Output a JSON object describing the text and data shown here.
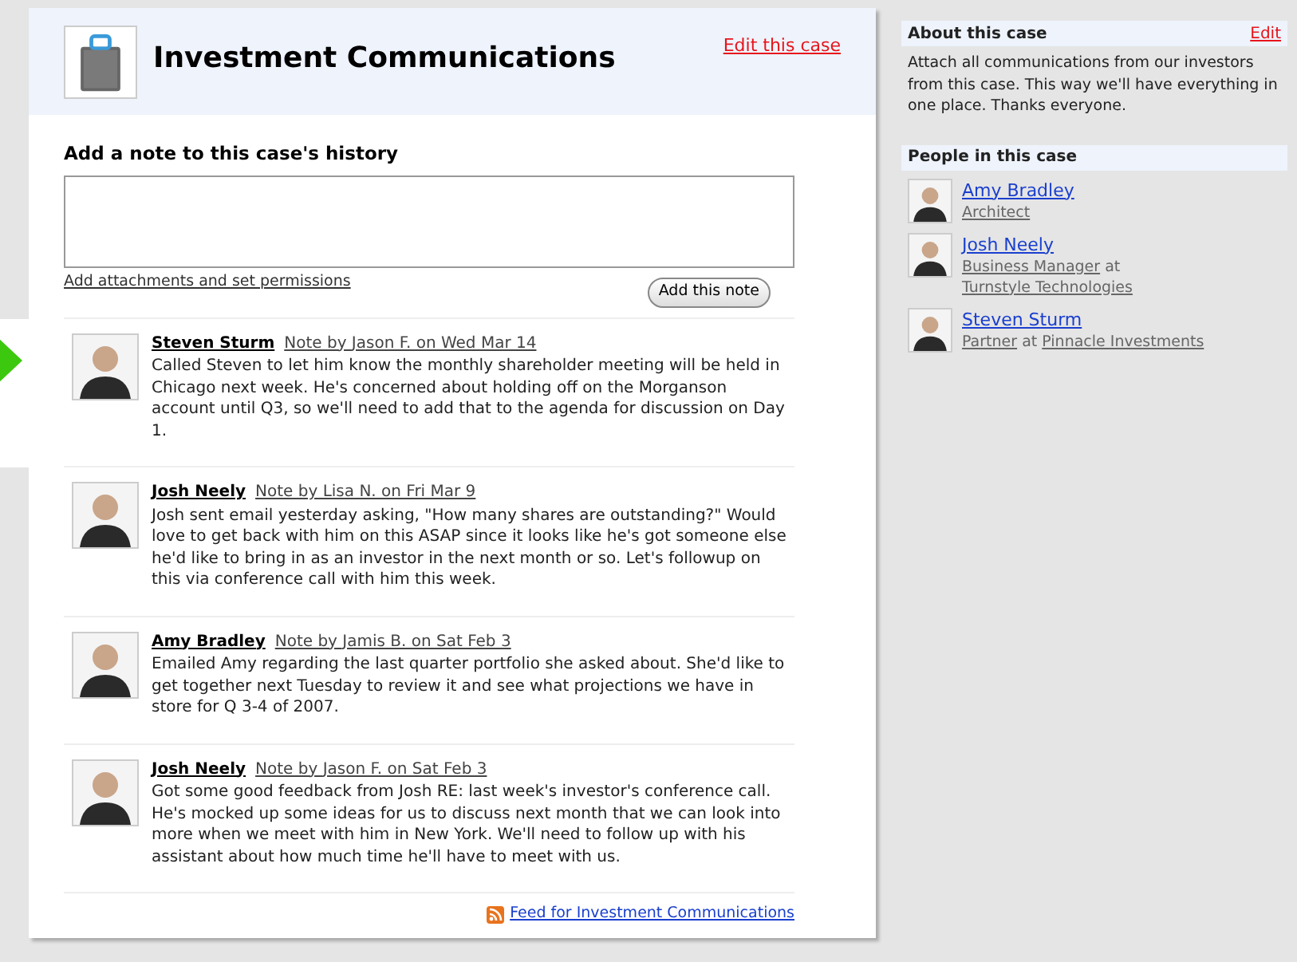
{
  "case": {
    "title": "Investment Communications",
    "edit_link": "Edit this case"
  },
  "note_form": {
    "heading": "Add a note to this case's history",
    "attachments_link": "Add attachments and set permissions",
    "submit": "Add this note"
  },
  "notes": [
    {
      "person": "Steven Sturm",
      "meta": "Note by Jason F. on Wed Mar 14",
      "body": "Called Steven to let him know the monthly shareholder meeting will be held in Chicago next week. He's concerned about holding off on the Morganson account until Q3, so we'll need to add that to the agenda for discussion on Day 1.",
      "highlighted": true
    },
    {
      "person": "Josh Neely",
      "meta": "Note by Lisa N. on Fri Mar 9",
      "body": "Josh sent email yesterday asking, \"How many shares are outstanding?\" Would love to get back with him on this ASAP since it looks like he's got someone else he'd like to bring in as an investor in the next month or so. Let's followup on this via conference call with him this week.",
      "highlighted": false
    },
    {
      "person": "Amy Bradley",
      "meta": "Note by Jamis B. on Sat Feb 3",
      "body": "Emailed Amy regarding the last quarter portfolio she asked about. She'd like to get together next Tuesday to review it and see what projections we have in store for Q 3-4 of 2007.",
      "highlighted": false
    },
    {
      "person": "Josh Neely",
      "meta": "Note by Jason F. on Sat Feb 3",
      "body": "Got some good feedback from Josh RE: last week's investor's conference call. He's mocked up some ideas for us to discuss next month that we can look into more when we meet with him in New York. We'll need to follow up with his assistant about how much time he'll have to meet with us.",
      "highlighted": false
    }
  ],
  "feed_link": "Feed for Investment Communications",
  "about": {
    "heading": "About this case",
    "edit": "Edit",
    "text": "Attach all communications from our investors from this case. This way we'll have everything in one place. Thanks everyone."
  },
  "people": {
    "heading": "People in this case",
    "items": [
      {
        "name": "Amy Bradley",
        "role": "Architect"
      },
      {
        "name": "Josh Neely",
        "role": "Business Manager",
        "joiner": "at",
        "company": "Turnstyle Technologies"
      },
      {
        "name": "Steven Sturm",
        "role": "Partner",
        "joiner": "at",
        "company": "Pinnacle Investments"
      }
    ]
  }
}
